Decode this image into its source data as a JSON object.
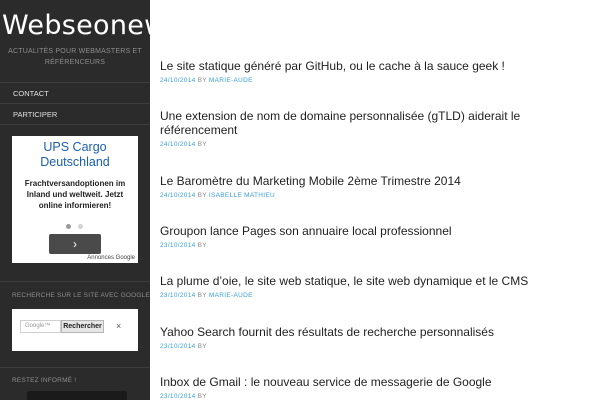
{
  "site": {
    "title": "Webseonews",
    "tagline": "ACTUALITÉS POUR WEBMASTERS ET RÉFÉRENCEURS"
  },
  "nav": {
    "items": [
      {
        "label": "CONTACT"
      },
      {
        "label": "PARTICIPER"
      }
    ]
  },
  "ad": {
    "title": "UPS Cargo Deutschland",
    "text": "Frachtversandoptionen im Inland und weltweit. Jetzt online informieren!",
    "next_icon": "›",
    "label": "Annonces Google"
  },
  "search_widget": {
    "heading": "RECHERCHE SUR LE SITE AVEC GOOGLE",
    "placeholder": "Google™",
    "button_label": "Rechercher",
    "clear_icon": "×"
  },
  "follow_widget": {
    "heading": "RESTEZ INFORMÉ !"
  },
  "posts": [
    {
      "title": "Le site statique généré par GitHub, ou le cache à la sauce geek !",
      "date": "24/10/2014",
      "by": "BY",
      "author": "MARIE-AUDE"
    },
    {
      "title": "Une extension de nom de domaine personnalisée (gTLD) aiderait le référencement",
      "date": "24/10/2014",
      "by": "BY",
      "author": ""
    },
    {
      "title": "Le Baromètre du Marketing Mobile 2ème Trimestre 2014",
      "date": "24/10/2014",
      "by": "BY",
      "author": "ISABELLE MATHIEU"
    },
    {
      "title": "Groupon lance Pages son annuaire local professionnel",
      "date": "23/10/2014",
      "by": "BY",
      "author": ""
    },
    {
      "title": "La plume d’oie, le site web statique, le site web dynamique et le CMS",
      "date": "23/10/2014",
      "by": "BY",
      "author": "MARIE-AUDE"
    },
    {
      "title": "Yahoo Search fournit des résultats de recherche personnalisés",
      "date": "23/10/2014",
      "by": "BY",
      "author": ""
    },
    {
      "title": "Inbox de Gmail : le nouveau service de messagerie de Google",
      "date": "23/10/2014",
      "by": "BY",
      "author": ""
    }
  ]
}
